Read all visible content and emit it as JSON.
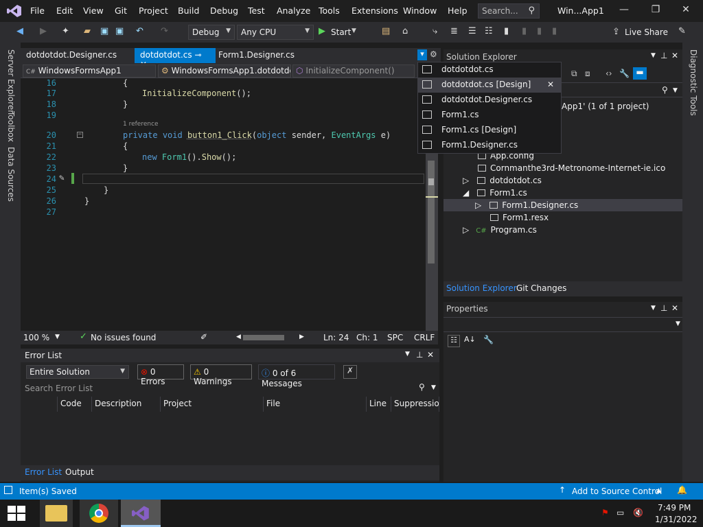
{
  "menu": [
    "File",
    "Edit",
    "View",
    "Git",
    "Project",
    "Build",
    "Debug",
    "Test",
    "Analyze",
    "Tools",
    "Extensions",
    "Window",
    "Help"
  ],
  "search": {
    "placeholder": "Search..."
  },
  "window_title": "Win...App1",
  "toolbar": {
    "config": "Debug",
    "platform": "Any CPU",
    "start": "Start",
    "live_share": "Live Share"
  },
  "left_strip": [
    "Server Explorer",
    "Toolbox",
    "Data Sources"
  ],
  "tabs": [
    {
      "label": "dotdotdot.Designer.cs"
    },
    {
      "label": "dotdotdot.cs",
      "pin": "⊸"
    },
    {
      "label": "Form1.Designer.cs"
    }
  ],
  "navbar": {
    "project": "WindowsFormsApp1",
    "class": "WindowsFormsApp1.dotdotdo",
    "member": "InitializeComponent()"
  },
  "editor": {
    "lines": [
      "16",
      "17",
      "18",
      "19",
      "20",
      "21",
      "22",
      "23",
      "24",
      "25",
      "26",
      "27"
    ],
    "reference_hint": "1 reference",
    "code_l16": "{",
    "code_l17_call": "InitializeComponent",
    "code_l17_rest": "();",
    "code_l18": "}",
    "code_l20_kw1": "private",
    "code_l20_kw2": "void",
    "code_l20_name": "button1_Click",
    "code_l20_p1": "(",
    "code_l20_kw3": "object",
    "code_l20_p2": " sender, ",
    "code_l20_ty": "EventArgs",
    "code_l20_p3": " e)",
    "code_l21": "{",
    "code_l22_kw": "new",
    "code_l22_ty": "Form1",
    "code_l22_p": "().",
    "code_l22_m": "Show",
    "code_l22_end": "();",
    "code_l23": "}",
    "code_l25": "}",
    "code_l26": "}"
  },
  "edit_status": {
    "zoom": "100 %",
    "issues": "No issues found",
    "ln": "Ln: 24",
    "ch": "Ch: 1",
    "spc": "SPC",
    "crlf": "CRLF"
  },
  "error_list": {
    "title": "Error List",
    "scope": "Entire Solution",
    "errors": "0 Errors",
    "warnings": "0 Warnings",
    "messages": "0 of 6 Messages",
    "search_placeholder": "Search Error List",
    "columns": [
      "Code",
      "Description",
      "Project",
      "File",
      "Line",
      "Suppression"
    ]
  },
  "bottom_tabs": [
    "Error List",
    "Output"
  ],
  "solution_explorer": {
    "title": "Solution Explorer",
    "solution_suffix": "App1' (1 of 1 project)",
    "items": [
      "App.config",
      "Cornmanthe3rd-Metronome-Internet-ie.ico",
      "dotdotdot.cs",
      "Form1.cs",
      "Form1.Designer.cs",
      "Form1.resx",
      "Program.cs"
    ],
    "tabs": [
      "Solution Explorer",
      "Git Changes"
    ]
  },
  "properties": {
    "title": "Properties"
  },
  "right_strip": "Diagnostic Tools",
  "dropdown": [
    {
      "label": "dotdotdot.cs"
    },
    {
      "label": "dotdotdot.cs [Design]",
      "close": "✕"
    },
    {
      "label": "dotdotdot.Designer.cs"
    },
    {
      "label": "Form1.cs"
    },
    {
      "label": "Form1.cs [Design]"
    },
    {
      "label": "Form1.Designer.cs"
    }
  ],
  "statusbar": {
    "left": "Item(s) Saved",
    "source_control": "Add to Source Control"
  },
  "taskbar": {
    "time": "7:49 PM",
    "date": "1/31/2022"
  },
  "colors": {
    "accent": "#007acc",
    "vs_purple": "#865fc5"
  }
}
